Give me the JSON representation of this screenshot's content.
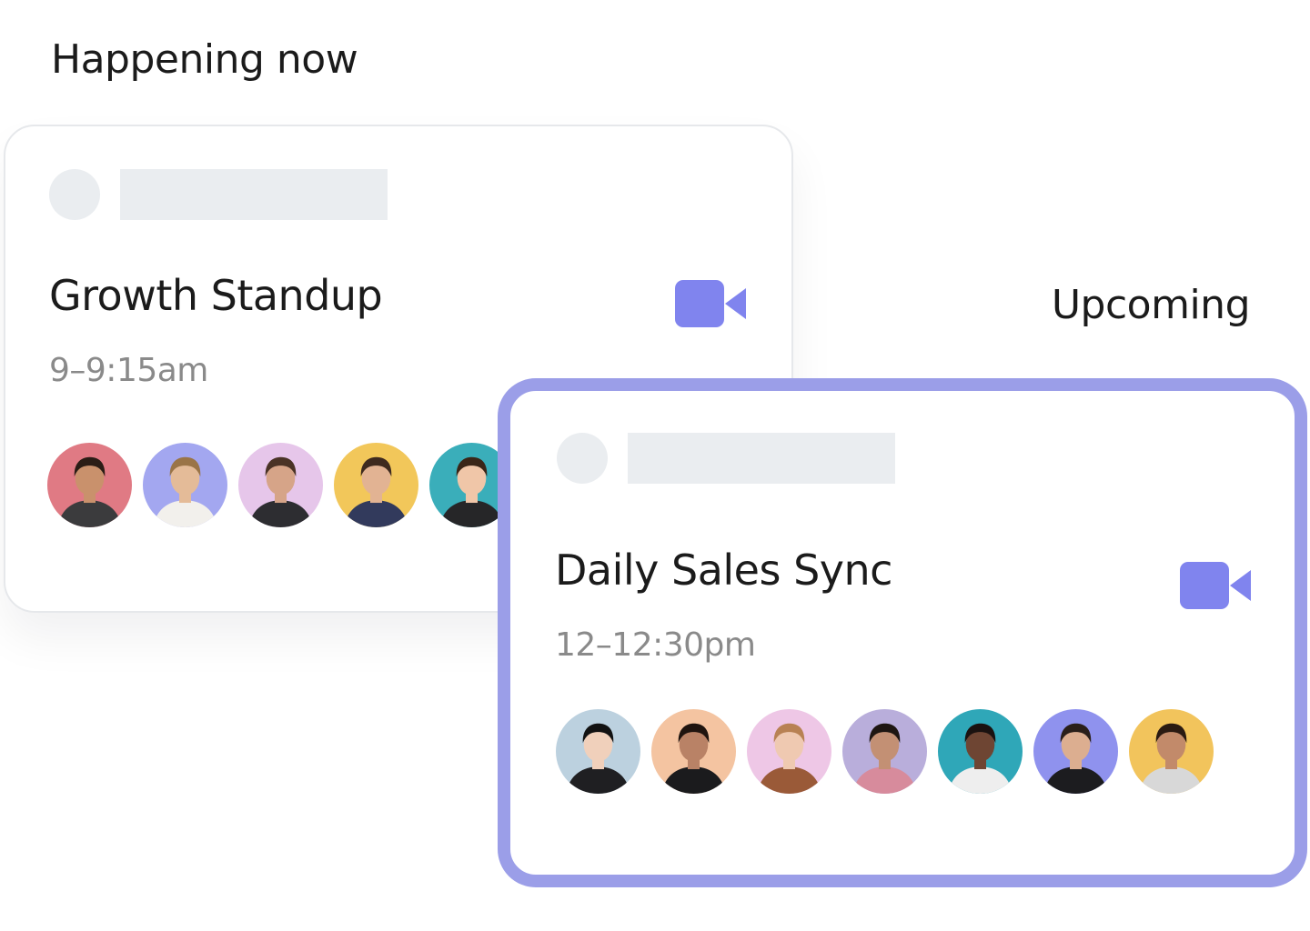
{
  "sections": {
    "happening_now": "Happening now",
    "upcoming": "Upcoming"
  },
  "colors": {
    "accent": "#8084ee",
    "highlight_border": "#9b9ee8",
    "skeleton": "#eaedf0",
    "muted_text": "#8a8a8a"
  },
  "events": [
    {
      "title": "Growth Standup",
      "time": "9–9:15am",
      "icon": "video-camera-icon",
      "attendees": [
        {
          "bg": "#e07a84",
          "skin": "#c9916c",
          "hair": "#2b1d16",
          "shirt": "#3b3b3d"
        },
        {
          "bg": "#a3a7f0",
          "skin": "#e4bb98",
          "hair": "#9a7447",
          "shirt": "#f2f0ec"
        },
        {
          "bg": "#e6c6ea",
          "skin": "#d6a488",
          "hair": "#4a3326",
          "shirt": "#2d2d31"
        },
        {
          "bg": "#f2c75a",
          "skin": "#e2b393",
          "hair": "#3e2a1f",
          "shirt": "#323a5c"
        },
        {
          "bg": "#3aaeba",
          "skin": "#f0c6a8",
          "hair": "#3a2618",
          "shirt": "#262628"
        }
      ]
    },
    {
      "title": "Daily Sales Sync",
      "time": "12–12:30pm",
      "icon": "video-camera-icon",
      "attendees": [
        {
          "bg": "#bcd1df",
          "skin": "#f0d0bb",
          "hair": "#121212",
          "shirt": "#1f1f22"
        },
        {
          "bg": "#f4c4a1",
          "skin": "#b98266",
          "hair": "#1f140f",
          "shirt": "#1b1b1d"
        },
        {
          "bg": "#eec7e6",
          "skin": "#efc9b1",
          "hair": "#b88153",
          "shirt": "#9a5a38"
        },
        {
          "bg": "#b9aedb",
          "skin": "#c39074",
          "hair": "#1e1612",
          "shirt": "#d78b9c"
        },
        {
          "bg": "#2fa7b8",
          "skin": "#6e4533",
          "hair": "#1a1210",
          "shirt": "#eeeeee"
        },
        {
          "bg": "#8f92ee",
          "skin": "#dcae90",
          "hair": "#2a1f1a",
          "shirt": "#1c1c1f"
        },
        {
          "bg": "#f2c45c",
          "skin": "#c28a6a",
          "hair": "#2a1a12",
          "shirt": "#d8d8d8"
        }
      ]
    }
  ]
}
